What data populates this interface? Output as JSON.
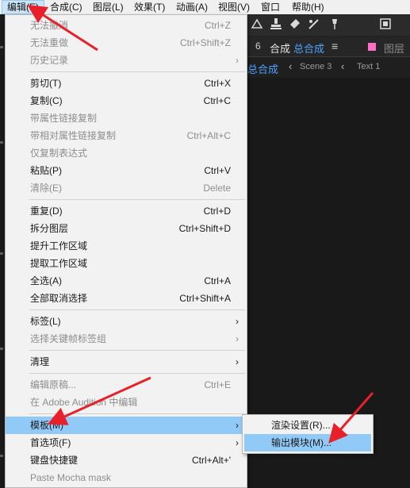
{
  "menubar": {
    "items": [
      {
        "label": "编辑(E)",
        "active": true
      },
      {
        "label": "合成(C)"
      },
      {
        "label": "图层(L)"
      },
      {
        "label": "效果(T)"
      },
      {
        "label": "动画(A)"
      },
      {
        "label": "视图(V)"
      },
      {
        "label": "窗口"
      },
      {
        "label": "帮助(H)"
      }
    ]
  },
  "composition_panel": {
    "tab_title_prefix": "合成",
    "tab_title_name": "总合成",
    "layer_tab_label": "图层",
    "breadcrumbs": [
      "总合成",
      "Scene 3",
      "Text 1"
    ]
  },
  "edit_menu": {
    "items": [
      {
        "label": "无法撤消",
        "shortcut": "Ctrl+Z",
        "disabled": true
      },
      {
        "label": "无法重做",
        "shortcut": "Ctrl+Shift+Z",
        "disabled": true
      },
      {
        "label": "历史记录",
        "shortcut": "",
        "disabled": true,
        "submenu": true
      },
      {
        "label": "剪切(T)",
        "shortcut": "Ctrl+X"
      },
      {
        "label": "复制(C)",
        "shortcut": "Ctrl+C"
      },
      {
        "label": "带属性链接复制",
        "shortcut": "",
        "disabled": true
      },
      {
        "label": "带相对属性链接复制",
        "shortcut": "Ctrl+Alt+C",
        "disabled": true
      },
      {
        "label": "仅复制表达式",
        "shortcut": "",
        "disabled": true
      },
      {
        "label": "粘贴(P)",
        "shortcut": "Ctrl+V"
      },
      {
        "label": "清除(E)",
        "shortcut": "Delete",
        "disabled": true
      },
      {
        "label": "重复(D)",
        "shortcut": "Ctrl+D"
      },
      {
        "label": "拆分图层",
        "shortcut": "Ctrl+Shift+D"
      },
      {
        "label": "提升工作区域",
        "shortcut": ""
      },
      {
        "label": "提取工作区域",
        "shortcut": ""
      },
      {
        "label": "全选(A)",
        "shortcut": "Ctrl+A"
      },
      {
        "label": "全部取消选择",
        "shortcut": "Ctrl+Shift+A"
      },
      {
        "label": "标签(L)",
        "shortcut": "",
        "submenu": true
      },
      {
        "label": "选择关键帧标签组",
        "shortcut": "",
        "disabled": true,
        "submenu": true
      },
      {
        "label": "清理",
        "shortcut": "",
        "submenu": true
      },
      {
        "label": "编辑原稿...",
        "shortcut": "Ctrl+E",
        "disabled": true
      },
      {
        "label": "在 Adobe Audition 中编辑",
        "shortcut": "",
        "disabled": true
      },
      {
        "label": "模板(M)",
        "shortcut": "",
        "submenu": true,
        "highlighted": true
      },
      {
        "label": "首选项(F)",
        "shortcut": "",
        "submenu": true
      },
      {
        "label": "键盘快捷键",
        "shortcut": "Ctrl+Alt+'"
      },
      {
        "label": "Paste Mocha mask",
        "shortcut": "",
        "disabled": true
      }
    ]
  },
  "template_submenu": {
    "items": [
      {
        "label": "渲染设置(R)..."
      },
      {
        "label": "输出模块(M)...",
        "highlighted": true
      }
    ]
  },
  "icons": {
    "submenu_arrow": "chevron-right-icon",
    "toolbar": [
      "shape-icon",
      "brush-icon",
      "clone-stamp-icon",
      "eraser-icon",
      "roto-brush-icon",
      "puppet-pin-icon",
      "snap-icon"
    ],
    "annotation": "red-arrow-icon"
  },
  "colors": {
    "highlight": "#91c9f7",
    "menubar_active": "#cce4f7",
    "annotation_arrow": "#e8202a",
    "comp_name_blue": "#4aa3ff",
    "layer_swatch": "#ff6fc8"
  }
}
